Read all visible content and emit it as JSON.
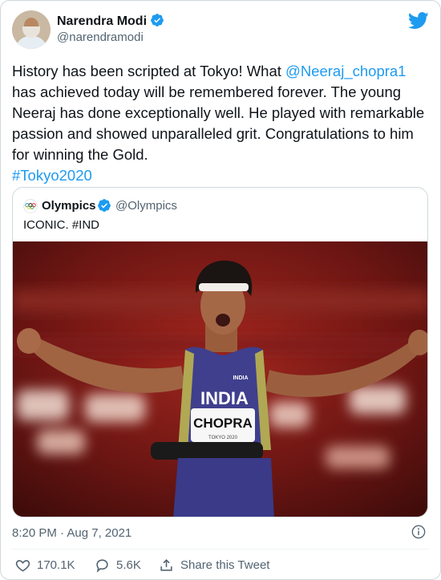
{
  "author": {
    "name": "Narendra Modi",
    "handle": "@narendramodi"
  },
  "tweet": {
    "text_before": "History has been scripted at Tokyo! What ",
    "mention": "@Neeraj_chopra1",
    "text_after": " has achieved today will be remembered forever. The young Neeraj has done exceptionally well. He played with remarkable passion and showed unparalleled grit. Congratulations to him for winning the Gold.",
    "hashtag": "#Tokyo2020"
  },
  "quoted": {
    "name": "Olympics",
    "handle": "@Olympics",
    "text": "ICONIC. #IND",
    "photo": {
      "vest_text": "INDIA",
      "bib_text": "CHOPRA",
      "logo_text": "INDIA",
      "tokyo_text": "TOKYO 2020"
    }
  },
  "meta": {
    "timestamp": "8:20 PM · Aug 7, 2021"
  },
  "actions": {
    "likes": "170.1K",
    "replies": "5.6K",
    "share_label": "Share this Tweet"
  },
  "colors": {
    "accent": "#1d9bf0",
    "text": "#0f1419",
    "secondary": "#536471"
  }
}
